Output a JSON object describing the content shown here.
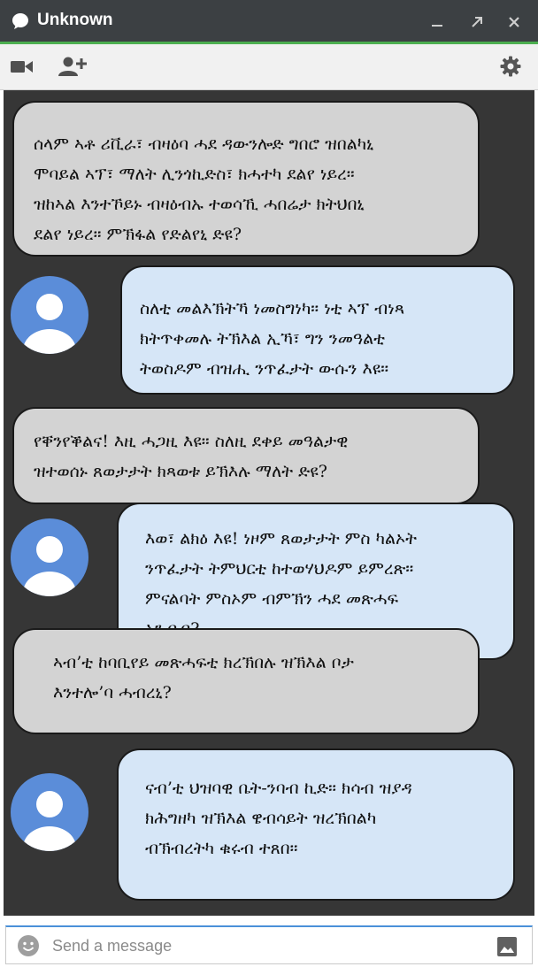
{
  "window": {
    "title": "Unknown",
    "title_icon": "chat-bubble-icon",
    "controls": [
      "minimize-icon",
      "expand-icon",
      "close-icon"
    ]
  },
  "toolbar": {
    "left_icons": [
      "video-camera-icon",
      "add-person-icon"
    ],
    "right_icons": [
      "gear-icon"
    ]
  },
  "colors": {
    "titlebar": "#3c4043",
    "accent": "#4caf50",
    "chat_background": "#363636",
    "incoming_bubble": "#d3d3d3",
    "outgoing_bubble": "#d6e6f7",
    "avatar": "#5b8dd9"
  },
  "messages": [
    {
      "side": "incoming",
      "text": "ሰላም ኣቶ ሪቪራ፣ ብዛዕባ ሓደ ዳውንሎድ ግበሮ ዝበልካኒ\nሞባይል ኣፕ፣ ማለት ሊንጎኪድስ፣ ክሓተካ ደልየ ነይረ።\nዝከኣል እንተኾይኑ ብዛዕብኡ ተወሳኺ ሓበሬታ ክትህበኒ\nደልየ ነይረ። ምኽፋል የድልየኒ ድዩ?"
    },
    {
      "side": "outgoing",
      "text": "ስለቲ መልእኽትኻ ነመስግነካ። ነቲ ኣፕ ብነጻ\nክትጥቀመሉ ትኽእል ኢኻ፣ ግን ንመዓልቲ\nትወስዶም ብዝሒ ንጥፈታት ውሱን እዩ።"
    },
    {
      "side": "incoming",
      "text": "የቐንየቕልና! እዚ ሓጋዚ እዩ። ስለዚ ደቀይ መዓልታዊ\nዝተወሰኑ ጸወታታት ክጻወቱ ይኽእሉ ማለት ድዩ?"
    },
    {
      "side": "outgoing",
      "text": "እወ፣ ልክዕ እዩ! ነዞም ጸወታታት ምስ ካልኦት\nንጥፈታት ትምህርቲ ከተወሃህዶም ይምረጽ።\nምናልባት ምስኦም ብምኽን ሓደ መጽሓፍ\nኣንብብ?"
    },
    {
      "side": "incoming",
      "text": "ኣብ’ቲ ከባቢየይ መጽሓፍቲ ክረኽበሉ ዝኽእል ቦታ\nእንተሎ’ባ ሓብረኒ?"
    },
    {
      "side": "outgoing",
      "text": "ናብ’ቲ ህዝባዊ ቤት-ንባብ ኪድ። ክሳብ ዝያዳ\nክሕግዘካ ዝኽእል ዌብሳይት ዝረኽበልካ\nብኽብረትካ ቁሩብ ተጸበ።"
    }
  ],
  "composer": {
    "placeholder": "Send a message",
    "value": "",
    "left_icon": "emoji-icon",
    "right_icon": "image-icon"
  }
}
